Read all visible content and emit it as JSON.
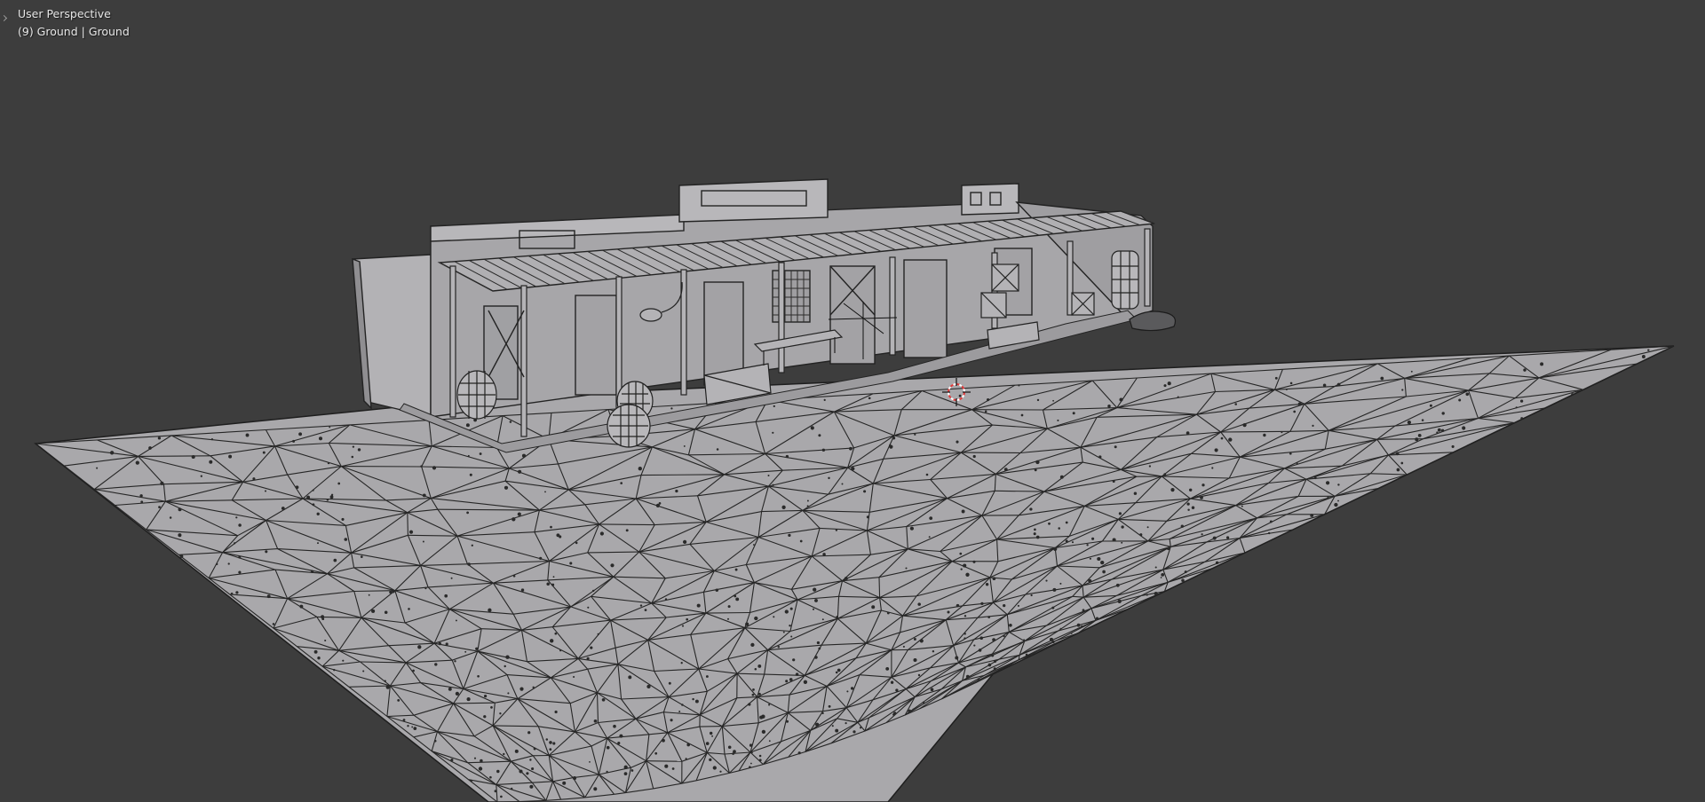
{
  "viewport": {
    "view_name": "User Perspective",
    "active_object": "(9) Ground | Ground",
    "background_color": "#3d3d3d",
    "mesh_color": "#a9a8ab",
    "wire_color": "#1e1e1e",
    "cursor_color": "#e23a3a"
  },
  "toolbar_toggle": {
    "icon": "chevron-right-icon"
  }
}
